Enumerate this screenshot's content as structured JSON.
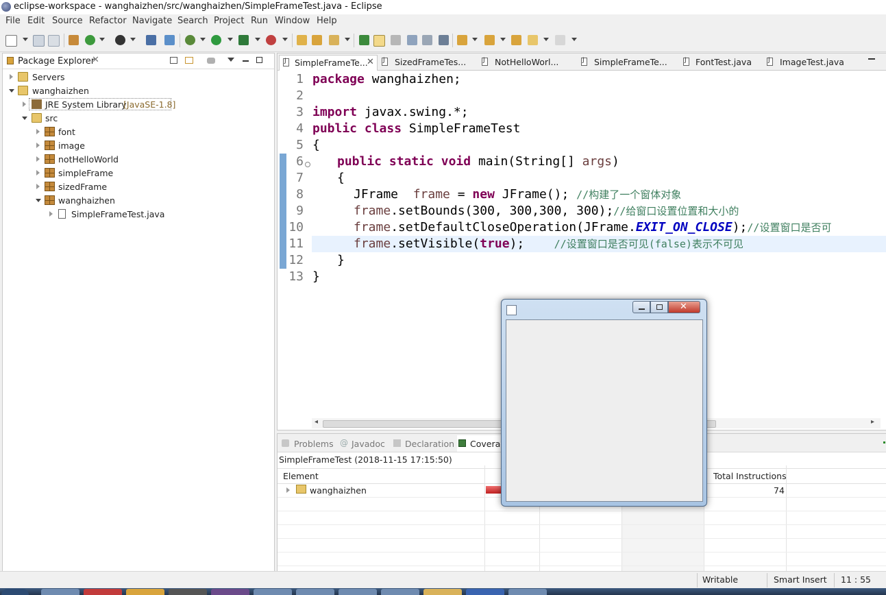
{
  "window": {
    "title": "eclipse-workspace - wanghaizhen/src/wanghaizhen/SimpleFrameTest.java - Eclipse"
  },
  "menu": [
    "File",
    "Edit",
    "Source",
    "Refactor",
    "Navigate",
    "Search",
    "Project",
    "Run",
    "Window",
    "Help"
  ],
  "package_explorer": {
    "title": "Package Explorer",
    "tree": {
      "servers": "Servers",
      "project": "wanghaizhen",
      "jre": "JRE System Library",
      "jre_version": "[JavaSE-1.8]",
      "src": "src",
      "packages": [
        "font",
        "image",
        "notHelloWorld",
        "simpleFrame",
        "sizedFrame",
        "wanghaizhen"
      ],
      "file": "SimpleFrameTest.java"
    }
  },
  "editor": {
    "tabs": [
      "SimpleFrameTe...",
      "SizedFrameTes...",
      "NotHelloWorl...",
      "SimpleFrameTe...",
      "FontTest.java",
      "ImageTest.java"
    ],
    "line_numbers": [
      "1",
      "2",
      "3",
      "4",
      "5",
      "6",
      "7",
      "8",
      "9",
      "10",
      "11",
      "12",
      "13"
    ],
    "code": {
      "l1a": "package",
      "l1b": " wanghaizhen;",
      "l3a": "import",
      "l3b": " javax.swing.*;",
      "l4a": "public",
      "l4b": " ",
      "l4c": "class",
      "l4d": " SimpleFrameTest",
      "l5": "{",
      "l6a": "public",
      "l6b": "static",
      "l6c": "void",
      "l6d": " main(String[] ",
      "l6e": "args",
      "l6f": ")",
      "l7": "{",
      "l8a": "JFrame  ",
      "l8b": "frame",
      "l8c": " = ",
      "l8d": "new",
      "l8e": " JFrame(); ",
      "l8f": "//构建了一个窗体对象",
      "l9a": "frame",
      "l9b": ".setBounds(300, 300,300, 300);",
      "l9c": "//给窗口设置位置和大小的",
      "l10a": "frame",
      "l10b": ".setDefaultCloseOperation(JFrame.",
      "l10c": "EXIT_ON_CLOSE",
      "l10d": ");",
      "l10e": "//设置窗口是否可",
      "l11a": "frame",
      "l11b": ".setVisible(",
      "l11c": "true",
      "l11d": ");",
      "l11e": "//设置窗口是否可见(false)表示不可见",
      "l12": "}",
      "l13": "}"
    }
  },
  "bottom_panel": {
    "tabs": [
      "Problems",
      "Javadoc",
      "Declaration",
      "Coverag"
    ],
    "session": "SimpleFrameTest (2018-11-15 17:15:50)",
    "columns": {
      "element": "Element",
      "total": "Total Instructions"
    },
    "row": {
      "name": "wanghaizhen",
      "total": "74"
    }
  },
  "status_bar": {
    "mode": "Writable",
    "insert": "Smart Insert",
    "position": "11 : 55"
  },
  "colors": {
    "keyword": "#7f0055",
    "comment": "#3f7f5f",
    "field": "#0000c0",
    "highlight": "#e8f2fe"
  }
}
